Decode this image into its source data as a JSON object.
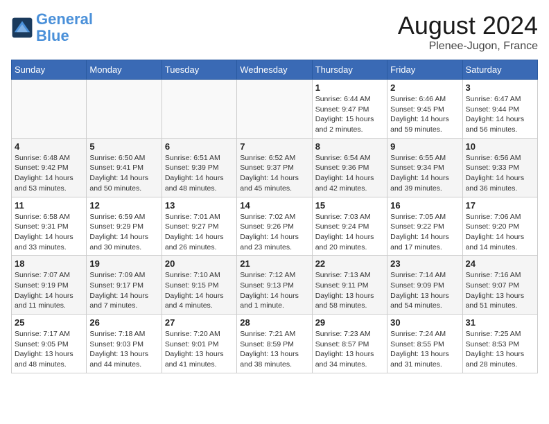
{
  "logo": {
    "line1": "General",
    "line2": "Blue"
  },
  "title": "August 2024",
  "subtitle": "Plenee-Jugon, France",
  "days_of_week": [
    "Sunday",
    "Monday",
    "Tuesday",
    "Wednesday",
    "Thursday",
    "Friday",
    "Saturday"
  ],
  "weeks": [
    [
      {
        "num": "",
        "info": ""
      },
      {
        "num": "",
        "info": ""
      },
      {
        "num": "",
        "info": ""
      },
      {
        "num": "",
        "info": ""
      },
      {
        "num": "1",
        "info": "Sunrise: 6:44 AM\nSunset: 9:47 PM\nDaylight: 15 hours\nand 2 minutes."
      },
      {
        "num": "2",
        "info": "Sunrise: 6:46 AM\nSunset: 9:45 PM\nDaylight: 14 hours\nand 59 minutes."
      },
      {
        "num": "3",
        "info": "Sunrise: 6:47 AM\nSunset: 9:44 PM\nDaylight: 14 hours\nand 56 minutes."
      }
    ],
    [
      {
        "num": "4",
        "info": "Sunrise: 6:48 AM\nSunset: 9:42 PM\nDaylight: 14 hours\nand 53 minutes."
      },
      {
        "num": "5",
        "info": "Sunrise: 6:50 AM\nSunset: 9:41 PM\nDaylight: 14 hours\nand 50 minutes."
      },
      {
        "num": "6",
        "info": "Sunrise: 6:51 AM\nSunset: 9:39 PM\nDaylight: 14 hours\nand 48 minutes."
      },
      {
        "num": "7",
        "info": "Sunrise: 6:52 AM\nSunset: 9:37 PM\nDaylight: 14 hours\nand 45 minutes."
      },
      {
        "num": "8",
        "info": "Sunrise: 6:54 AM\nSunset: 9:36 PM\nDaylight: 14 hours\nand 42 minutes."
      },
      {
        "num": "9",
        "info": "Sunrise: 6:55 AM\nSunset: 9:34 PM\nDaylight: 14 hours\nand 39 minutes."
      },
      {
        "num": "10",
        "info": "Sunrise: 6:56 AM\nSunset: 9:33 PM\nDaylight: 14 hours\nand 36 minutes."
      }
    ],
    [
      {
        "num": "11",
        "info": "Sunrise: 6:58 AM\nSunset: 9:31 PM\nDaylight: 14 hours\nand 33 minutes."
      },
      {
        "num": "12",
        "info": "Sunrise: 6:59 AM\nSunset: 9:29 PM\nDaylight: 14 hours\nand 30 minutes."
      },
      {
        "num": "13",
        "info": "Sunrise: 7:01 AM\nSunset: 9:27 PM\nDaylight: 14 hours\nand 26 minutes."
      },
      {
        "num": "14",
        "info": "Sunrise: 7:02 AM\nSunset: 9:26 PM\nDaylight: 14 hours\nand 23 minutes."
      },
      {
        "num": "15",
        "info": "Sunrise: 7:03 AM\nSunset: 9:24 PM\nDaylight: 14 hours\nand 20 minutes."
      },
      {
        "num": "16",
        "info": "Sunrise: 7:05 AM\nSunset: 9:22 PM\nDaylight: 14 hours\nand 17 minutes."
      },
      {
        "num": "17",
        "info": "Sunrise: 7:06 AM\nSunset: 9:20 PM\nDaylight: 14 hours\nand 14 minutes."
      }
    ],
    [
      {
        "num": "18",
        "info": "Sunrise: 7:07 AM\nSunset: 9:19 PM\nDaylight: 14 hours\nand 11 minutes."
      },
      {
        "num": "19",
        "info": "Sunrise: 7:09 AM\nSunset: 9:17 PM\nDaylight: 14 hours\nand 7 minutes."
      },
      {
        "num": "20",
        "info": "Sunrise: 7:10 AM\nSunset: 9:15 PM\nDaylight: 14 hours\nand 4 minutes."
      },
      {
        "num": "21",
        "info": "Sunrise: 7:12 AM\nSunset: 9:13 PM\nDaylight: 14 hours\nand 1 minute."
      },
      {
        "num": "22",
        "info": "Sunrise: 7:13 AM\nSunset: 9:11 PM\nDaylight: 13 hours\nand 58 minutes."
      },
      {
        "num": "23",
        "info": "Sunrise: 7:14 AM\nSunset: 9:09 PM\nDaylight: 13 hours\nand 54 minutes."
      },
      {
        "num": "24",
        "info": "Sunrise: 7:16 AM\nSunset: 9:07 PM\nDaylight: 13 hours\nand 51 minutes."
      }
    ],
    [
      {
        "num": "25",
        "info": "Sunrise: 7:17 AM\nSunset: 9:05 PM\nDaylight: 13 hours\nand 48 minutes."
      },
      {
        "num": "26",
        "info": "Sunrise: 7:18 AM\nSunset: 9:03 PM\nDaylight: 13 hours\nand 44 minutes."
      },
      {
        "num": "27",
        "info": "Sunrise: 7:20 AM\nSunset: 9:01 PM\nDaylight: 13 hours\nand 41 minutes."
      },
      {
        "num": "28",
        "info": "Sunrise: 7:21 AM\nSunset: 8:59 PM\nDaylight: 13 hours\nand 38 minutes."
      },
      {
        "num": "29",
        "info": "Sunrise: 7:23 AM\nSunset: 8:57 PM\nDaylight: 13 hours\nand 34 minutes."
      },
      {
        "num": "30",
        "info": "Sunrise: 7:24 AM\nSunset: 8:55 PM\nDaylight: 13 hours\nand 31 minutes."
      },
      {
        "num": "31",
        "info": "Sunrise: 7:25 AM\nSunset: 8:53 PM\nDaylight: 13 hours\nand 28 minutes."
      }
    ]
  ]
}
